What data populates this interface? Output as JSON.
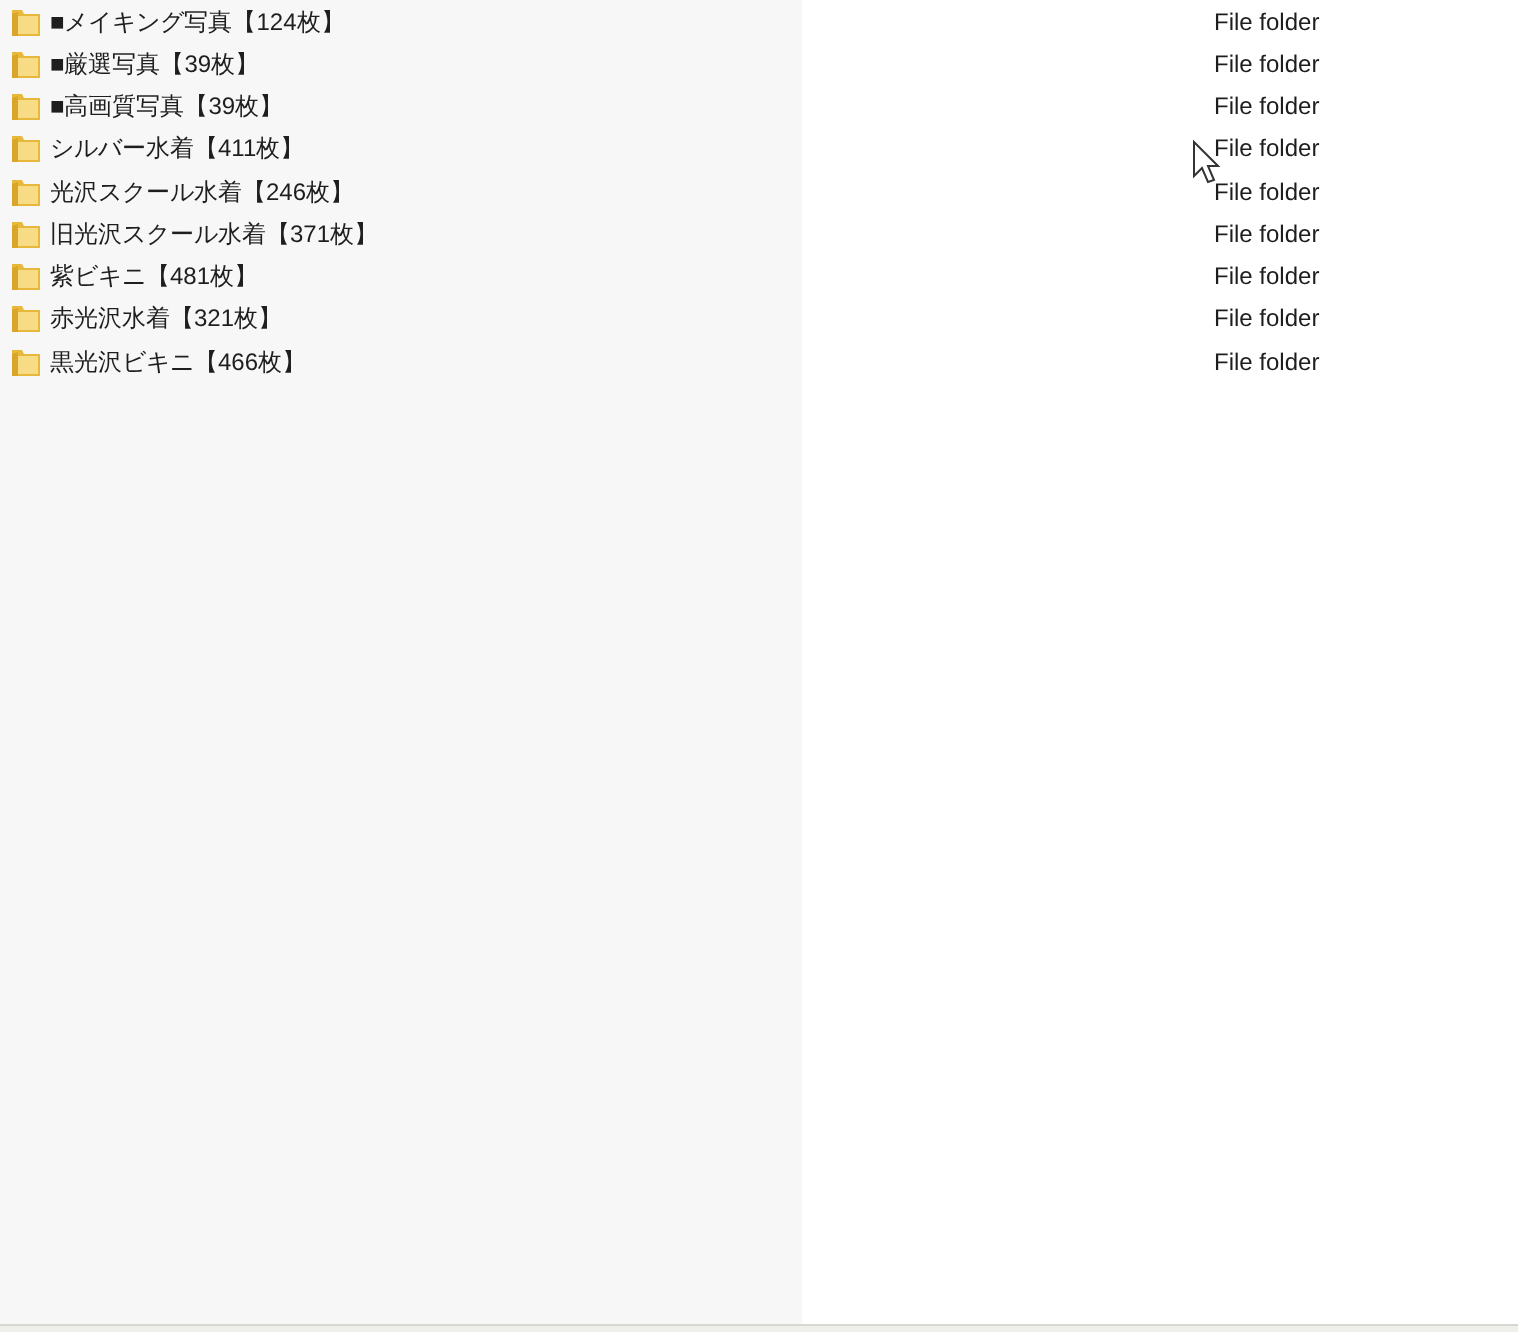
{
  "files": [
    {
      "name": "■メイキング写真【124枚】",
      "type": "File folder"
    },
    {
      "name": "■厳選写真【39枚】",
      "type": "File folder"
    },
    {
      "name": "■高画質写真【39枚】",
      "type": "File folder"
    },
    {
      "name": "シルバー水着【411枚】",
      "type": "File folder"
    },
    {
      "name": "光沢スクール水着【246枚】",
      "type": "File folder"
    },
    {
      "name": "旧光沢スクール水着【371枚】",
      "type": "File folder"
    },
    {
      "name": "紫ビキニ【481枚】",
      "type": "File folder"
    },
    {
      "name": "赤光沢水着【321枚】",
      "type": "File folder"
    },
    {
      "name": "黒光沢ビキニ【466枚】",
      "type": "File folder"
    }
  ]
}
